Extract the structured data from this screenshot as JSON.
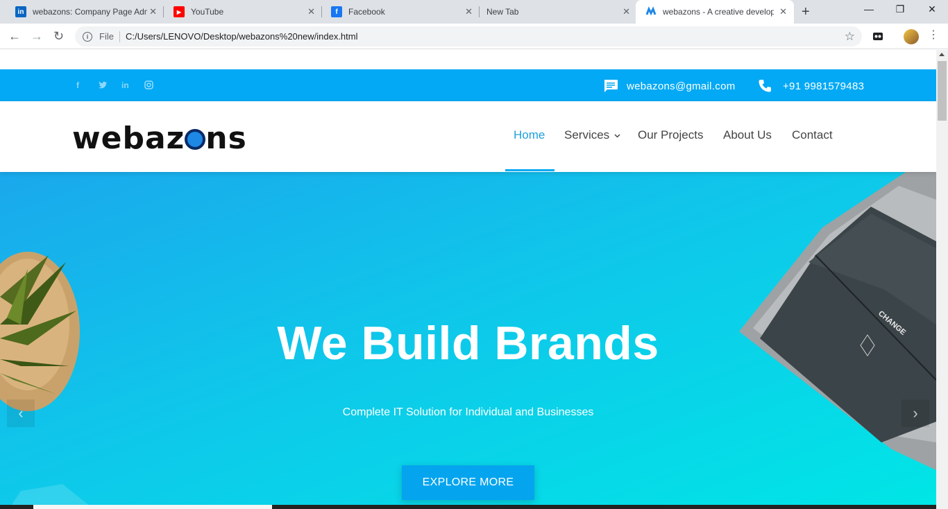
{
  "browser": {
    "tabs": [
      {
        "title": "webazons: Company Page Adm",
        "icon": "linkedin-icon",
        "color": "#0a66c2",
        "glyph": "in"
      },
      {
        "title": "YouTube",
        "icon": "youtube-icon",
        "color": "#ff0000",
        "glyph": "▶"
      },
      {
        "title": "Facebook",
        "icon": "facebook-icon",
        "color": "#1877f2",
        "glyph": "f"
      },
      {
        "title": "New Tab",
        "icon": "",
        "color": "",
        "glyph": ""
      },
      {
        "title": "webazons - A creative develop",
        "icon": "webazons-icon",
        "color": "#1e88e5",
        "glyph": "W"
      }
    ],
    "address": {
      "scheme_label": "File",
      "url": "C:/Users/LENOVO/Desktop/webazons%20new/index.html"
    }
  },
  "site": {
    "topbar": {
      "social": [
        "facebook",
        "twitter",
        "linkedin",
        "instagram"
      ],
      "email": "webazons@gmail.com",
      "phone": "+91 9981579483"
    },
    "logo": {
      "pre": "webaz",
      "post": "ns"
    },
    "nav": [
      "Home",
      "Services",
      "Our Projects",
      "About Us",
      "Contact"
    ],
    "active_nav": "Home",
    "hero": {
      "title": "We Build Brands",
      "subtitle": "Complete IT Solution for Individual and Businesses",
      "cta": "EXPLORE MORE"
    },
    "colors": {
      "accent": "#03a9f4",
      "hero_start": "#1aa8ec",
      "hero_end": "#00e6e6"
    }
  }
}
